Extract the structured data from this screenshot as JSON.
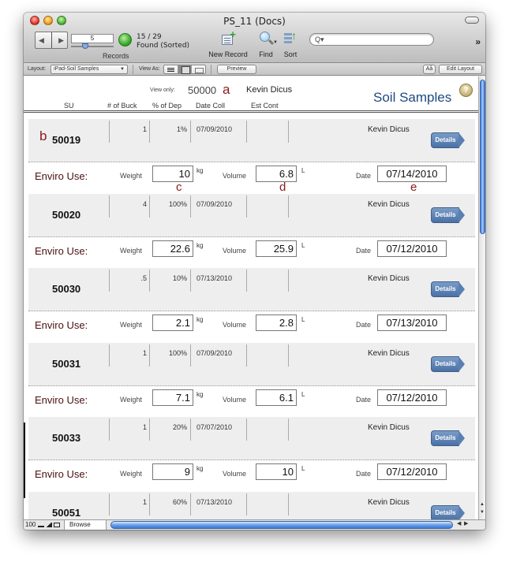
{
  "window": {
    "title": "PS_11 (Docs)"
  },
  "toolbar": {
    "current_record": "5",
    "records_label": "Records",
    "found_count": "15 / 29",
    "found_status": "Found (Sorted)",
    "new_record_label": "New Record",
    "find_label": "Find",
    "sort_label": "Sort",
    "search_placeholder": "",
    "search_icon": "Q▾",
    "overflow_icon": "»"
  },
  "layout_bar": {
    "layout_label": "Layout:",
    "layout_value": "iPad-Soil Samples",
    "view_as_label": "View As:",
    "preview_label": "Preview",
    "font_size_label": "Aå",
    "edit_layout_label": "Edit Layout"
  },
  "header": {
    "view_only_label": "View only:",
    "view_only_value": "50000",
    "annotation_a": "a",
    "person": "Kevin Dicus",
    "title": "Soil Samples",
    "help_icon": "?",
    "columns": [
      "SU",
      "# of Buck",
      "% of Dep",
      "Date Coll",
      "Est Cont"
    ]
  },
  "labels": {
    "enviro_use": "Enviro Use:",
    "weight": "Weight",
    "volume": "Volume",
    "date": "Date",
    "weight_unit": "kg",
    "volume_unit": "L",
    "details": "Details"
  },
  "annotations": {
    "b": "b",
    "c": "c",
    "d": "d",
    "e": "e"
  },
  "records": [
    {
      "su": "50019",
      "buckets": "1",
      "pct_dep": "1%",
      "date_coll": "07/09/2010",
      "est_cont": "",
      "person": "Kevin Dicus",
      "weight": "10",
      "volume": "6.8",
      "date": "07/14/2010"
    },
    {
      "su": "50020",
      "buckets": "4",
      "pct_dep": "100%",
      "date_coll": "07/09/2010",
      "est_cont": "",
      "person": "Kevin Dicus",
      "weight": "22.6",
      "volume": "25.9",
      "date": "07/12/2010"
    },
    {
      "su": "50030",
      "buckets": ".5",
      "pct_dep": "10%",
      "date_coll": "07/13/2010",
      "est_cont": "",
      "person": "Kevin Dicus",
      "weight": "2.1",
      "volume": "2.8",
      "date": "07/13/2010"
    },
    {
      "su": "50031",
      "buckets": "1",
      "pct_dep": "100%",
      "date_coll": "07/09/2010",
      "est_cont": "",
      "person": "Kevin Dicus",
      "weight": "7.1",
      "volume": "6.1",
      "date": "07/12/2010"
    },
    {
      "su": "50033",
      "buckets": "1",
      "pct_dep": "20%",
      "date_coll": "07/07/2010",
      "est_cont": "",
      "person": "Kevin Dicus",
      "weight": "9",
      "volume": "10",
      "date": "07/12/2010"
    },
    {
      "su": "50051",
      "buckets": "1",
      "pct_dep": "60%",
      "date_coll": "07/13/2010",
      "est_cont": "",
      "person": "Kevin Dicus",
      "weight": "",
      "volume": "",
      "date": ""
    }
  ],
  "status_bar": {
    "zoom": "100",
    "mode": "Browse"
  }
}
